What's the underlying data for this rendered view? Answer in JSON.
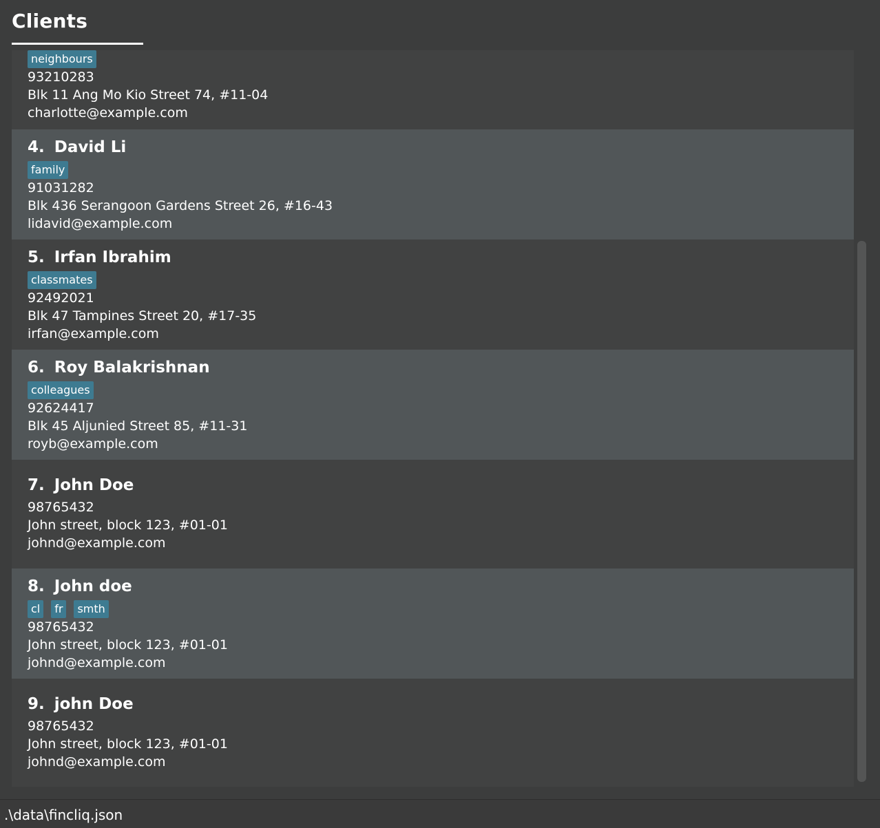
{
  "header": {
    "tab_title": "Clients"
  },
  "clients": [
    {
      "index": "",
      "name": "",
      "tags": [
        "neighbours"
      ],
      "phone": "93210283",
      "address": "Blk 11 Ang Mo Kio Street 74, #11-04",
      "email": "charlotte@example.com"
    },
    {
      "index": "4.",
      "name": "David Li",
      "tags": [
        "family"
      ],
      "phone": "91031282",
      "address": "Blk 436 Serangoon Gardens Street 26, #16-43",
      "email": "lidavid@example.com"
    },
    {
      "index": "5.",
      "name": "Irfan Ibrahim",
      "tags": [
        "classmates"
      ],
      "phone": "92492021",
      "address": "Blk 47 Tampines Street 20, #17-35",
      "email": "irfan@example.com"
    },
    {
      "index": "6.",
      "name": "Roy Balakrishnan",
      "tags": [
        "colleagues"
      ],
      "phone": "92624417",
      "address": "Blk 45 Aljunied Street 85, #11-31",
      "email": "royb@example.com"
    },
    {
      "index": "7.",
      "name": "John Doe",
      "tags": [],
      "phone": "98765432",
      "address": "John street, block 123, #01-01",
      "email": "johnd@example.com"
    },
    {
      "index": "8.",
      "name": "John doe",
      "tags": [
        "cl",
        "fr",
        "smth"
      ],
      "phone": "98765432",
      "address": "John street, block 123, #01-01",
      "email": "johnd@example.com"
    },
    {
      "index": "9.",
      "name": "john Doe",
      "tags": [],
      "phone": "98765432",
      "address": "John street, block 123, #01-01",
      "email": "johnd@example.com"
    }
  ],
  "status_bar": {
    "path": ".\\data\\fincliq.json"
  },
  "colors": {
    "background": "#3c3d3d",
    "card_alt": "#515658",
    "tag": "#3e7b91"
  }
}
